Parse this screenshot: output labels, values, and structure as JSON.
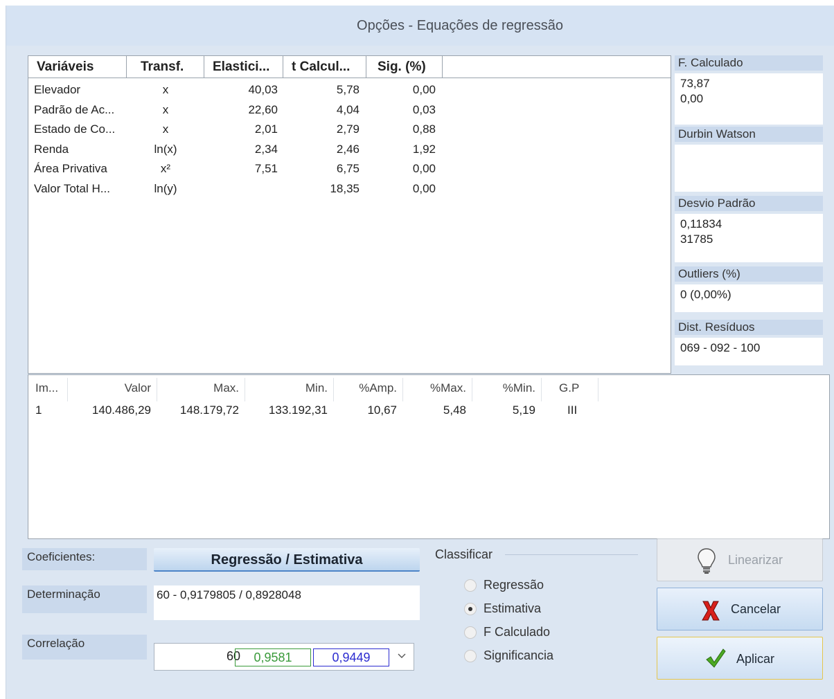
{
  "window": {
    "title": "Opções - Equações de regressão"
  },
  "variables_table": {
    "columns": [
      "Variáveis",
      "Transf.",
      "Elastici...",
      "t Calcul...",
      "Sig. (%)"
    ],
    "rows": [
      {
        "name": "Elevador",
        "transf": "x",
        "elast": "40,03",
        "tcalc": "5,78",
        "sig": "0,00"
      },
      {
        "name": "Padrão de Ac...",
        "transf": "x",
        "elast": "22,60",
        "tcalc": "4,04",
        "sig": "0,03"
      },
      {
        "name": "Estado de Co...",
        "transf": "x",
        "elast": "2,01",
        "tcalc": "2,79",
        "sig": "0,88"
      },
      {
        "name": "Renda",
        "transf": "ln(x)",
        "elast": "2,34",
        "tcalc": "2,46",
        "sig": "1,92"
      },
      {
        "name": "Área Privativa",
        "transf": "x²",
        "elast": "7,51",
        "tcalc": "6,75",
        "sig": "0,00"
      },
      {
        "name": "Valor Total H...",
        "transf": "ln(y)",
        "elast": "",
        "tcalc": "18,35",
        "sig": "0,00"
      }
    ]
  },
  "stats": {
    "f_label": "F. Calculado",
    "f_value1": "73,87",
    "f_value2": "0,00",
    "dw_label": "Durbin Watson",
    "dp_label": "Desvio Padrão",
    "dp_value1": "0,11834",
    "dp_value2": "31785",
    "outliers_label": "Outliers (%)",
    "outliers_value": "0  (0,00%)",
    "dist_label": "Dist. Resíduos",
    "dist_value": "069 - 092 - 100"
  },
  "estimates_table": {
    "columns": [
      "Im...",
      "Valor",
      "Max.",
      "Min.",
      "%Amp.",
      "%Max.",
      "%Min.",
      "G.P"
    ],
    "rows": [
      {
        "im": "1",
        "valor": "140.486,29",
        "max": "148.179,72",
        "min": "133.192,31",
        "amp": "10,67",
        "pmax": "5,48",
        "pmin": "5,19",
        "gp": "III"
      }
    ]
  },
  "bottom": {
    "coef_label": "Coeficientes:",
    "mode_button": "Regressão / Estimativa",
    "det_label": "Determinação",
    "det_value": "60 - 0,9179805 / 0,8928048",
    "corr_label": "Correlação",
    "corr_n": "60",
    "corr_v1": "0,9581",
    "corr_v2": "0,9449",
    "classify_label": "Classificar",
    "options": [
      "Regressão",
      "Estimativa",
      "F Calculado",
      "Significancia"
    ],
    "selected_option": "Estimativa",
    "linearize": "Linearizar",
    "cancel": "Cancelar",
    "apply": "Aplicar"
  },
  "colors": {
    "green_box": "#3a9a3a",
    "blue_box": "#2b2bd0",
    "accent": "#2f6fc4"
  }
}
